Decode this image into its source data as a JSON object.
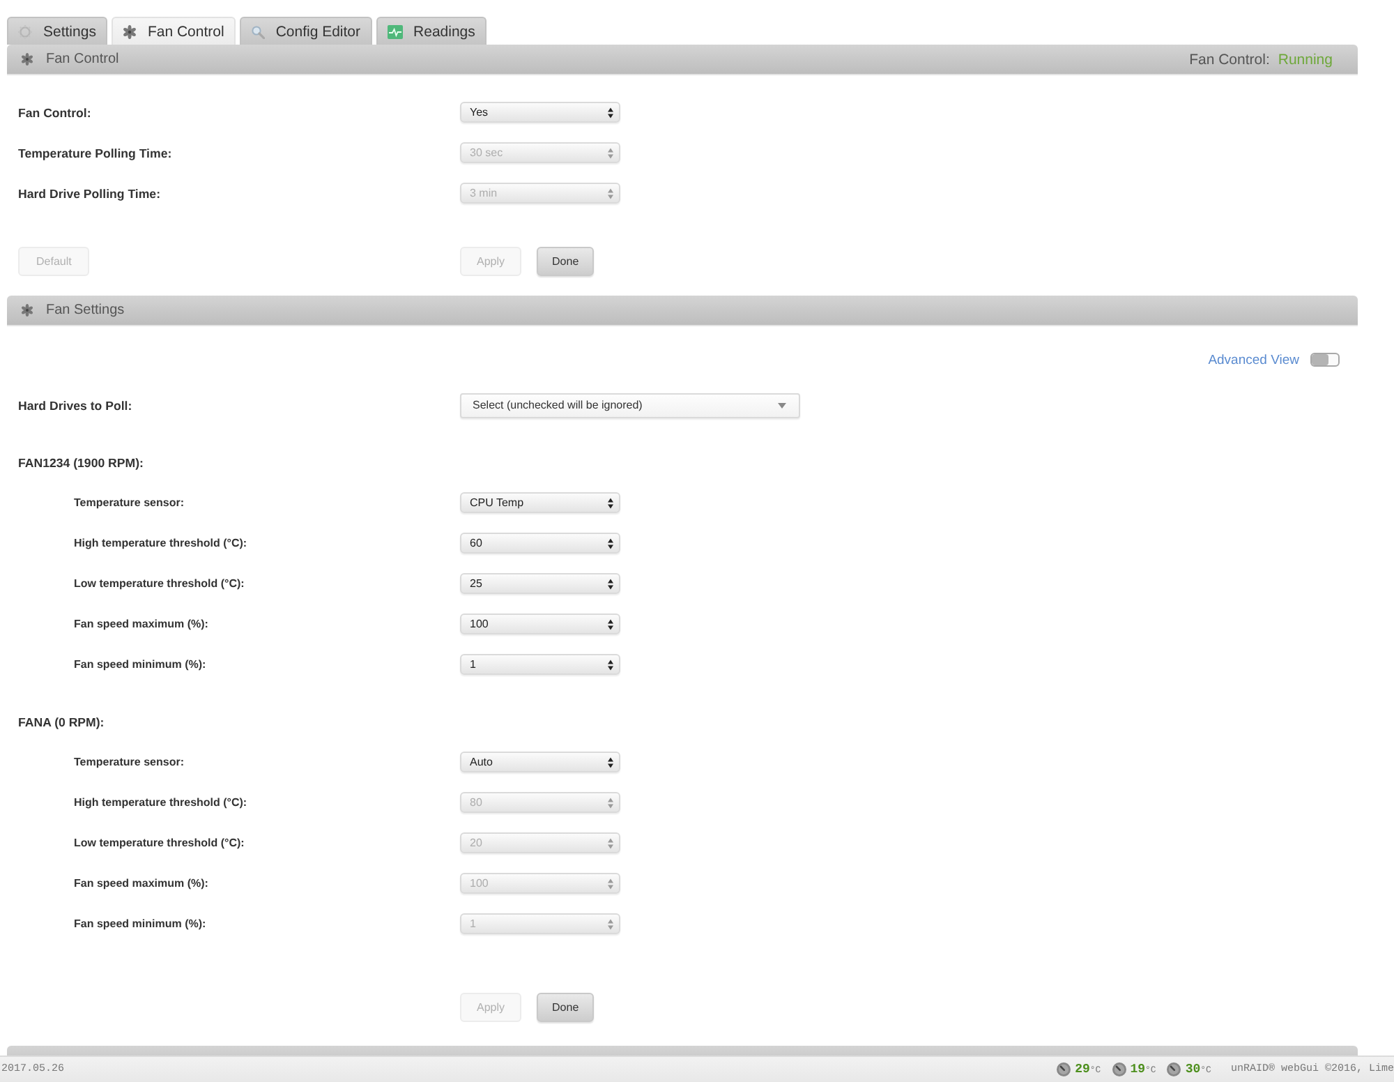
{
  "tabs": [
    {
      "label": "Settings",
      "selected": false
    },
    {
      "label": "Fan Control",
      "selected": true
    },
    {
      "label": "Config Editor",
      "selected": false
    },
    {
      "label": "Readings",
      "selected": false
    }
  ],
  "fan_control": {
    "title": "Fan Control",
    "status": {
      "label": "Fan Control:",
      "value": "Running"
    },
    "fields": [
      {
        "label": "Fan Control:",
        "value": "Yes",
        "disabled": false
      },
      {
        "label": "Temperature Polling Time:",
        "value": "30 sec",
        "disabled": true
      },
      {
        "label": "Hard Drive Polling Time:",
        "value": "3 min",
        "disabled": true
      }
    ],
    "default_button": {
      "label": "Default",
      "disabled": true
    },
    "buttons": [
      {
        "label": "Apply",
        "disabled": true
      },
      {
        "label": "Done",
        "disabled": false
      }
    ]
  },
  "fan_settings": {
    "title": "Fan Settings",
    "advanced_view": {
      "label": "Advanced View",
      "on": false
    },
    "drives": {
      "label": "Hard Drives to Poll:",
      "value": "Select (unchecked will be ignored)"
    },
    "fans": [
      {
        "name": "FAN1234 (1900 RPM):",
        "fields": [
          {
            "label": "Temperature sensor:",
            "value": "CPU Temp",
            "disabled": false
          },
          {
            "label": "High temperature threshold (°C):",
            "value": "60",
            "disabled": false
          },
          {
            "label": "Low temperature threshold (°C):",
            "value": "25",
            "disabled": false
          },
          {
            "label": "Fan speed maximum (%):",
            "value": "100",
            "disabled": false
          },
          {
            "label": "Fan speed minimum (%):",
            "value": "1",
            "disabled": false
          }
        ]
      },
      {
        "name": "FANA (0 RPM):",
        "fields": [
          {
            "label": "Temperature sensor:",
            "value": "Auto",
            "disabled": false
          },
          {
            "label": "High temperature threshold (°C):",
            "value": "80",
            "disabled": true
          },
          {
            "label": "Low temperature threshold (°C):",
            "value": "20",
            "disabled": true
          },
          {
            "label": "Fan speed maximum (%):",
            "value": "100",
            "disabled": true
          },
          {
            "label": "Fan speed minimum (%):",
            "value": "1",
            "disabled": true
          }
        ]
      }
    ],
    "buttons": [
      {
        "label": "Apply",
        "disabled": true
      },
      {
        "label": "Done",
        "disabled": false
      }
    ]
  },
  "footer": {
    "date": "2017.05.26",
    "temps": [
      {
        "value": "29",
        "unit": "°C"
      },
      {
        "value": "19",
        "unit": "°C"
      },
      {
        "value": "30",
        "unit": "°C"
      }
    ],
    "copyright": "unRAID® webGui ©2016, Lime"
  }
}
